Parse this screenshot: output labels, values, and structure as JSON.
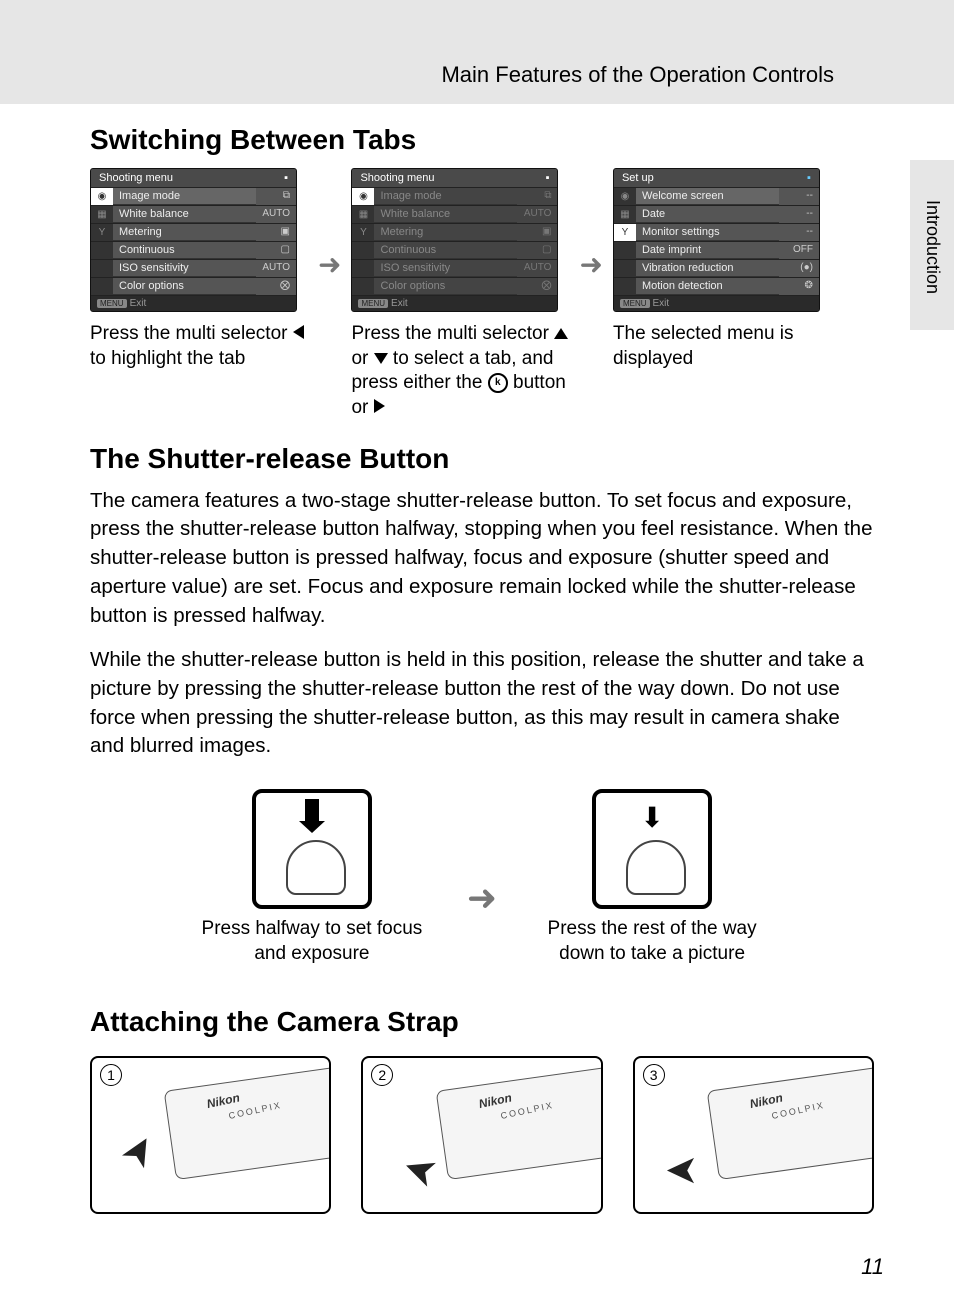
{
  "header": {
    "title": "Main Features of the Operation Controls",
    "side_tab": "Introduction"
  },
  "section1": {
    "heading": "Switching Between Tabs",
    "menus": {
      "left": {
        "title": "Shooting menu",
        "rows": [
          {
            "label": "Image mode",
            "val": "⧉"
          },
          {
            "label": "White balance",
            "val": "AUTO"
          },
          {
            "label": "Metering",
            "val": "▣"
          },
          {
            "label": "Continuous",
            "val": "▢"
          },
          {
            "label": "ISO sensitivity",
            "val": "AUTO"
          },
          {
            "label": "Color options",
            "val": "⨂"
          }
        ],
        "footer": "Exit"
      },
      "mid": {
        "title": "Shooting menu",
        "rows": [
          {
            "label": "Image mode",
            "val": "⧉"
          },
          {
            "label": "White balance",
            "val": "AUTO"
          },
          {
            "label": "Metering",
            "val": "▣"
          },
          {
            "label": "Continuous",
            "val": "▢"
          },
          {
            "label": "ISO sensitivity",
            "val": "AUTO"
          },
          {
            "label": "Color options",
            "val": "⨂"
          }
        ],
        "footer": "Exit"
      },
      "right": {
        "title": "Set up",
        "rows": [
          {
            "label": "Welcome screen",
            "val": "--"
          },
          {
            "label": "Date",
            "val": "--"
          },
          {
            "label": "Monitor settings",
            "val": "--"
          },
          {
            "label": "Date imprint",
            "val": "OFF"
          },
          {
            "label": "Vibration reduction",
            "val": "(●)"
          },
          {
            "label": "Motion detection",
            "val": "❂"
          }
        ],
        "footer": "Exit"
      }
    },
    "captions": {
      "left_a": "Press the multi selector ",
      "left_b": " to highlight the tab",
      "mid_a": "Press the multi selector ",
      "mid_b": " or ",
      "mid_c": " to select a tab, and press either the ",
      "mid_d": " button or ",
      "ok": "k",
      "right": "The selected menu is displayed"
    }
  },
  "section2": {
    "heading": "The Shutter-release Button",
    "p1": "The camera features a two-stage shutter-release button. To set focus and exposure, press the shutter-release button halfway, stopping when you feel resistance. When the shutter-release button is pressed halfway, focus and exposure (shutter speed and aperture value) are set. Focus and exposure remain locked while the shutter-release button is pressed halfway.",
    "p2": "While the shutter-release button is held in this position, release the shutter and take a picture by pressing the shutter-release button the rest of the way down. Do not use force when pressing the shutter-release button, as this may result in camera shake and blurred images.",
    "cap1": "Press halfway to set focus and exposure",
    "cap2": "Press the rest of the way down to take a picture"
  },
  "section3": {
    "heading": "Attaching the Camera Strap",
    "steps": [
      "1",
      "2",
      "3"
    ],
    "brand": "Nikon",
    "model": "COOLPIX"
  },
  "page_number": "11",
  "menu_tag": "MENU"
}
